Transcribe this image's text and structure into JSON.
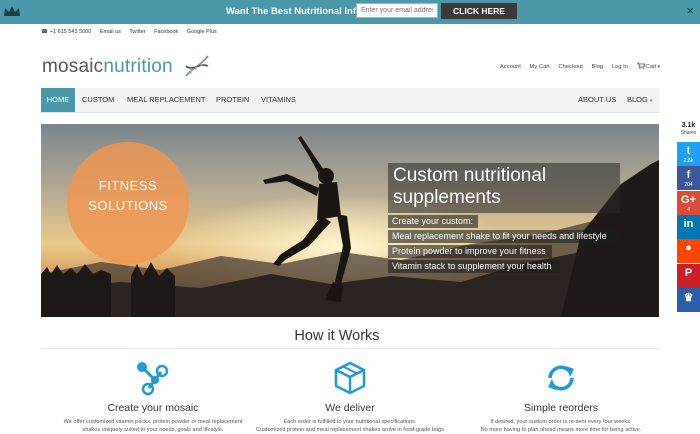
{
  "promo": {
    "message": "Want The Best Nutritional Info In Your Inbox?",
    "email_placeholder": "Enter your email addres",
    "button_label": "CLICK HERE",
    "close_label": "×"
  },
  "contact": {
    "phone": "+1 615 543 5000",
    "links": [
      "Email us",
      "Twitter",
      "Facebook",
      "Google Plus"
    ]
  },
  "logo": {
    "part1": "mosaic",
    "part2": "nutrition"
  },
  "account_nav": [
    "Account",
    "My Cart",
    "Checkout",
    "Blog",
    "Log In",
    "Cart"
  ],
  "main_nav": {
    "left": [
      "HOME",
      "CUSTOM",
      "MEAL REPLACEMENT",
      "PROTEIN",
      "VITAMINS"
    ],
    "right": [
      "ABOUT US",
      "BLOG"
    ]
  },
  "hero": {
    "badge": [
      "FITNESS",
      "SOLUTIONS"
    ],
    "headline": "Custom nutritional supplements",
    "lines": [
      "Create your custom:",
      "Meal replacement shake to fit your needs and lifestyle",
      "Protein powder to improve your fitness",
      "Vitamin stack to supplement your health"
    ]
  },
  "how_it_works": {
    "title": "How it Works",
    "steps": [
      {
        "title": "Create your mosaic",
        "desc": [
          "We offer customized vitamin packs, protein powder or meal replacement",
          "shakes uniquely suited to your needs, goals and lifestyle."
        ],
        "icon": "molecule-icon"
      },
      {
        "title": "We deliver",
        "desc": [
          "Each order is fulfilled to your nutritional specifications.",
          "Customized protein and meal replacement shakes arrive in food-grade bags"
        ],
        "icon": "package-icon"
      },
      {
        "title": "Simple reorders",
        "desc": [
          "If desired, your custom order is re-sent every four weeks.",
          "No more having to plan ahead means more time for being active."
        ],
        "icon": "refresh-icon"
      }
    ]
  },
  "social": {
    "total": "3.1k",
    "label": "Shares",
    "buttons": [
      {
        "name": "twitter",
        "glyph": "t",
        "count": "2.8k",
        "color": "#1da1f2"
      },
      {
        "name": "facebook",
        "glyph": "f",
        "count": "204",
        "color": "#3b5998"
      },
      {
        "name": "google-plus",
        "glyph": "G+",
        "count": "4",
        "color": "#dd4b39"
      },
      {
        "name": "linkedin",
        "glyph": "in",
        "count": "",
        "color": "#0077b5"
      },
      {
        "name": "reddit",
        "glyph": "●",
        "count": "",
        "color": "#ff4500"
      },
      {
        "name": "pinterest",
        "glyph": "P",
        "count": "",
        "color": "#cb2027"
      },
      {
        "name": "crown",
        "glyph": "♛",
        "count": "",
        "color": "#2b5ea8"
      }
    ]
  },
  "colors": {
    "teal": "#4a98a9",
    "orange": "#f0964f"
  }
}
